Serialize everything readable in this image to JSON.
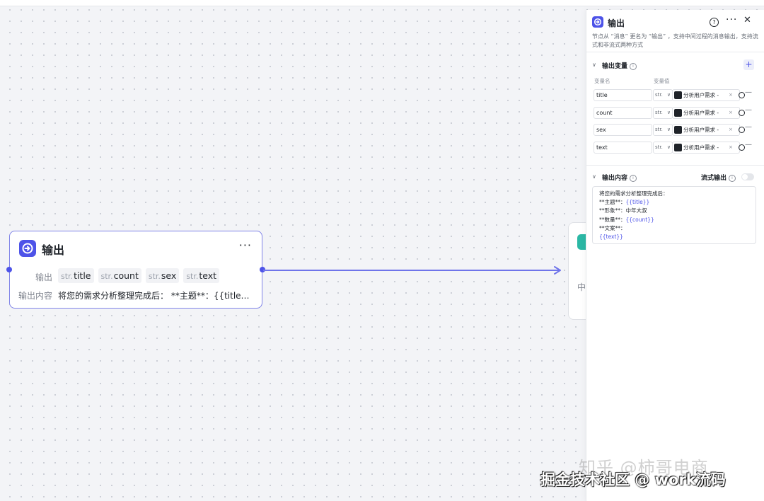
{
  "node": {
    "title": "输出",
    "more": "···",
    "output_label": "输出",
    "content_label": "输出内容",
    "chips": [
      {
        "type": "str.",
        "name": "title"
      },
      {
        "type": "str.",
        "name": "count"
      },
      {
        "type": "str.",
        "name": "sex"
      },
      {
        "type": "str.",
        "name": "text"
      }
    ],
    "content_preview": "将您的需求分析整理完成后：  **主题**：{{title…"
  },
  "next_node": {
    "text": "中"
  },
  "panel": {
    "title": "输出",
    "help": "?",
    "more": "···",
    "close": "✕",
    "description": "节点从 “消息” 更名为 “输出” ，支持中间过程的消息输出，支持流式和非流式两种方式",
    "vars_section": {
      "title": "输出变量",
      "col_name": "变量名",
      "col_value": "变量值",
      "add": "+",
      "rows": [
        {
          "name": "title",
          "type": "str.",
          "value": "分析用户需求 -",
          "remove": "×"
        },
        {
          "name": "count",
          "type": "str.",
          "value": "分析用户需求 -",
          "remove": "×"
        },
        {
          "name": "sex",
          "type": "str.",
          "value": "分析用户需求 -",
          "remove": "×"
        },
        {
          "name": "text",
          "type": "str.",
          "value": "分析用户需求 -",
          "remove": "×"
        }
      ]
    },
    "content_section": {
      "title": "输出内容",
      "stream_label": "流式输出",
      "stream_enabled": false,
      "lines": [
        {
          "text": "将您的需求分析整理完成后：",
          "var": ""
        },
        {
          "text": "**主题**：",
          "var": "{{title}}"
        },
        {
          "text": "**形象**：中年大叔",
          "var": ""
        },
        {
          "text": "**数量**：",
          "var": "{{count}}"
        },
        {
          "text": "**文案**：",
          "var": ""
        },
        {
          "text": "",
          "var": "{{text}}"
        }
      ]
    }
  },
  "watermark": {
    "zhihu": "知乎 @柿哥电商",
    "juejin": "掘金技术社区 @ work流码"
  },
  "colors": {
    "accent": "#4d53e8",
    "node_border": "#7f83e8",
    "teal": "#2bb8a5"
  }
}
